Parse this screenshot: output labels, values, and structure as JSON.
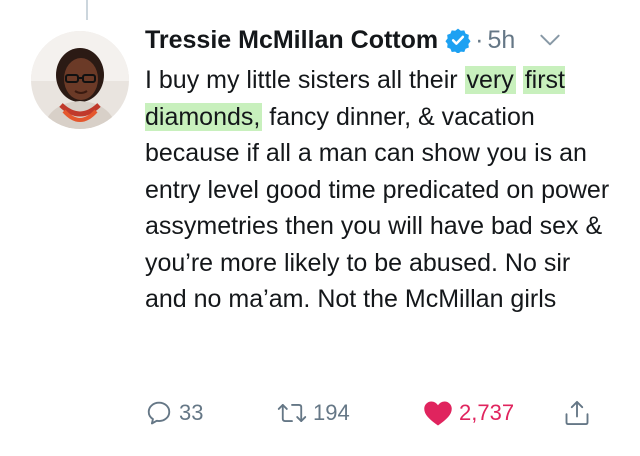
{
  "tweet": {
    "author_name": "Tressie McMillan Cottom",
    "separator": "·",
    "time": "5h",
    "text_before": "I buy my little sisters all their ",
    "text_highlight_1": "very",
    "text_highlight_2": "first diamonds,",
    "text_after": " fancy dinner, & vacation because if all a man can show you is an entry level good time predicated on power assymetries then you will have bad sex & you’re more likely to be abused. No sir and no ma’am. Not the McMillan girls",
    "highlight_color": "#c8f0bd"
  },
  "actions": {
    "reply_count": "33",
    "retweet_count": "194",
    "like_count": "2,737",
    "like_color": "#e0245e",
    "icons": [
      "reply-icon",
      "retweet-icon",
      "heart-icon",
      "share-icon"
    ]
  },
  "colors": {
    "verified": "#1da1f2",
    "muted": "#657786",
    "text": "#14171a"
  }
}
